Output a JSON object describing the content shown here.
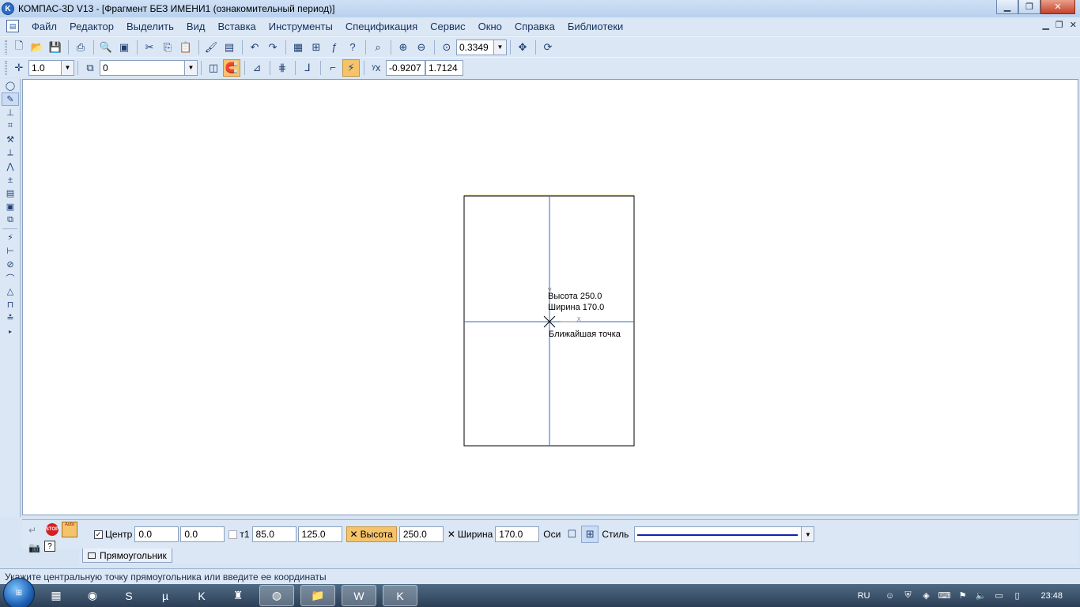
{
  "window": {
    "title": "КОМПАС-3D V13 - [Фрагмент БЕЗ ИМЕНИ1 (ознакомительный период)]",
    "app_icon_letter": "K"
  },
  "menu": {
    "items": [
      {
        "label": "Файл"
      },
      {
        "label": "Редактор"
      },
      {
        "label": "Выделить"
      },
      {
        "label": "Вид"
      },
      {
        "label": "Вставка"
      },
      {
        "label": "Инструменты"
      },
      {
        "label": "Спецификация"
      },
      {
        "label": "Сервис"
      },
      {
        "label": "Окно"
      },
      {
        "label": "Справка"
      },
      {
        "label": "Библиотеки"
      }
    ]
  },
  "toolbar1": {
    "zoom_value": "0.3349"
  },
  "toolbar2": {
    "step_value": "1.0",
    "layer_value": "0",
    "coord_x": "-0.9207",
    "coord_y": "1.7124"
  },
  "canvas": {
    "tooltip_height": "Высота 250.0",
    "tooltip_width": "Ширина 170.0",
    "tooltip_snap": "Ближайшая точка"
  },
  "properties": {
    "center_label": "Центр",
    "center_x": "0.0",
    "center_y": "0.0",
    "t1_label": "т1",
    "t1_x": "85.0",
    "t1_y": "125.0",
    "height_label": "Высота",
    "height_value": "250.0",
    "width_label": "Ширина",
    "width_value": "170.0",
    "axes_label": "Оси",
    "style_label": "Стиль",
    "stop_label": "STOP",
    "auto_label": "Auto",
    "tab_label": "Прямоугольник"
  },
  "status": {
    "text": "Укажите центральную точку прямоугольника или введите ее координаты"
  },
  "taskbar": {
    "lang": "RU",
    "clock": "23:48"
  }
}
